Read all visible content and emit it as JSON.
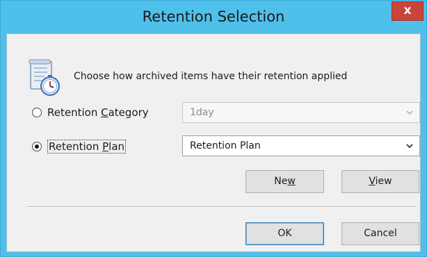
{
  "window": {
    "title": "Retention Selection",
    "close_label": "x"
  },
  "header": {
    "icon": "retention-calendar-clock-icon",
    "instruction": "Choose how archived items have their retention applied"
  },
  "options": {
    "category": {
      "label_before": "Retention ",
      "label_accel": "C",
      "label_after": "ategory",
      "selected": false,
      "combo_value": "1day",
      "enabled": false
    },
    "plan": {
      "label_before": "Retention ",
      "label_accel": "P",
      "label_after": "lan",
      "selected": true,
      "combo_value": "Retention Plan",
      "enabled": true
    }
  },
  "buttons": {
    "new": {
      "before": "Ne",
      "accel": "w",
      "after": ""
    },
    "view": {
      "before": "",
      "accel": "V",
      "after": "iew"
    },
    "ok": "OK",
    "cancel": "Cancel"
  },
  "colors": {
    "frame": "#4fc0ea",
    "close": "#c7453a",
    "client_bg": "#f0f0f0"
  }
}
